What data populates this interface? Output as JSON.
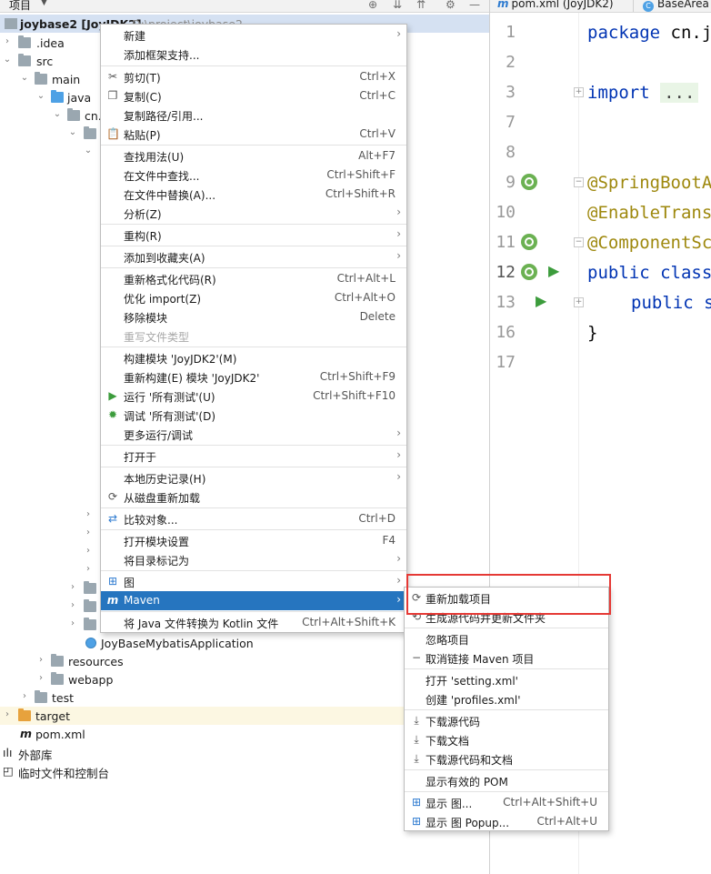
{
  "project_panel": {
    "title": "项目",
    "tree": [
      {
        "label": "joybase2 [JoyJDK2]",
        "path": "D:\\project\\joybase2"
      },
      {
        "label": ".idea"
      },
      {
        "label": "src"
      },
      {
        "label": "main"
      },
      {
        "label": "java"
      },
      {
        "label": "cn.j"
      },
      {
        "label": "JoyBaseMybatisApplication"
      },
      {
        "label": "resources"
      },
      {
        "label": "webapp"
      },
      {
        "label": "test"
      },
      {
        "label": "target"
      },
      {
        "label": "pom.xml"
      },
      {
        "label": "外部库"
      },
      {
        "label": "临时文件和控制台"
      }
    ]
  },
  "editor": {
    "tabs": [
      {
        "label": "pom.xml (JoyJDK2)",
        "icon": "maven-icon"
      },
      {
        "label": "BaseArea",
        "icon": "class-icon"
      }
    ],
    "line_numbers": [
      "1",
      "2",
      "3",
      "7",
      "8",
      "9",
      "10",
      "11",
      "12",
      "13",
      "16",
      "17"
    ],
    "code": {
      "l1_kw": "package",
      "l1_rest": " cn.j",
      "l3_kw": "import",
      "l3_folded": "...",
      "l9": "@SpringBootA",
      "l10": "@EnableTrans",
      "l11": "@ComponentSc",
      "l12_kw": "public class",
      "l13_kw": "public s",
      "l16": "}"
    }
  },
  "context_menu": {
    "items": [
      {
        "label": "新建"
      },
      {
        "label": "添加框架支持..."
      },
      {
        "label": "剪切(T)",
        "shortcut": "Ctrl+X",
        "icon": "scissors-icon"
      },
      {
        "label": "复制(C)",
        "shortcut": "Ctrl+C",
        "icon": "copy-icon"
      },
      {
        "label": "复制路径/引用..."
      },
      {
        "label": "粘贴(P)",
        "shortcut": "Ctrl+V",
        "icon": "paste-icon"
      },
      {
        "label": "查找用法(U)",
        "shortcut": "Alt+F7"
      },
      {
        "label": "在文件中查找...",
        "shortcut": "Ctrl+Shift+F"
      },
      {
        "label": "在文件中替换(A)...",
        "shortcut": "Ctrl+Shift+R"
      },
      {
        "label": "分析(Z)"
      },
      {
        "label": "重构(R)"
      },
      {
        "label": "添加到收藏夹(A)"
      },
      {
        "label": "重新格式化代码(R)",
        "shortcut": "Ctrl+Alt+L"
      },
      {
        "label": "优化 import(Z)",
        "shortcut": "Ctrl+Alt+O"
      },
      {
        "label": "移除模块",
        "shortcut": "Delete"
      },
      {
        "label": "重写文件类型"
      },
      {
        "label": "构建模块 'JoyJDK2'(M)"
      },
      {
        "label": "重新构建(E) 模块 'JoyJDK2'",
        "shortcut": "Ctrl+Shift+F9"
      },
      {
        "label": "运行 '所有测试'(U)",
        "shortcut": "Ctrl+Shift+F10",
        "icon": "run-icon"
      },
      {
        "label": "调试 '所有测试'(D)",
        "icon": "debug-icon"
      },
      {
        "label": "更多运行/调试"
      },
      {
        "label": "打开于"
      },
      {
        "label": "本地历史记录(H)"
      },
      {
        "label": "从磁盘重新加载",
        "icon": "reload-icon"
      },
      {
        "label": "比较对象...",
        "shortcut": "Ctrl+D",
        "icon": "compare-icon"
      },
      {
        "label": "打开模块设置",
        "shortcut": "F4"
      },
      {
        "label": "将目录标记为"
      },
      {
        "label": "图",
        "icon": "diagram-icon"
      },
      {
        "label": "Maven",
        "icon": "maven-icon"
      },
      {
        "label": "将 Java 文件转换为 Kotlin 文件",
        "shortcut": "Ctrl+Alt+Shift+K"
      }
    ]
  },
  "maven_submenu": {
    "items": [
      {
        "label": "重新加载项目",
        "icon": "reload-icon"
      },
      {
        "label": "生成源代码并更新文件夹",
        "icon": "generate-icon"
      },
      {
        "label": "忽略项目"
      },
      {
        "label": "取消链接 Maven 项目",
        "icon": "minus-icon"
      },
      {
        "label": "打开 'setting.xml'"
      },
      {
        "label": "创建 'profiles.xml'"
      },
      {
        "label": "下载源代码",
        "icon": "download-icon"
      },
      {
        "label": "下载文档",
        "icon": "download-icon"
      },
      {
        "label": "下载源代码和文档",
        "icon": "download-icon"
      },
      {
        "label": "显示有效的 POM"
      },
      {
        "label": "显示 图...",
        "shortcut": "Ctrl+Alt+Shift+U",
        "icon": "diagram-icon"
      },
      {
        "label": "显示 图 Popup...",
        "shortcut": "Ctrl+Alt+U",
        "icon": "diagram-icon"
      }
    ]
  },
  "colors": {
    "accent_selection": "#2675bf",
    "highlight_box": "#e53935",
    "keyword": "#0033b3",
    "annotation": "#9e880d"
  }
}
